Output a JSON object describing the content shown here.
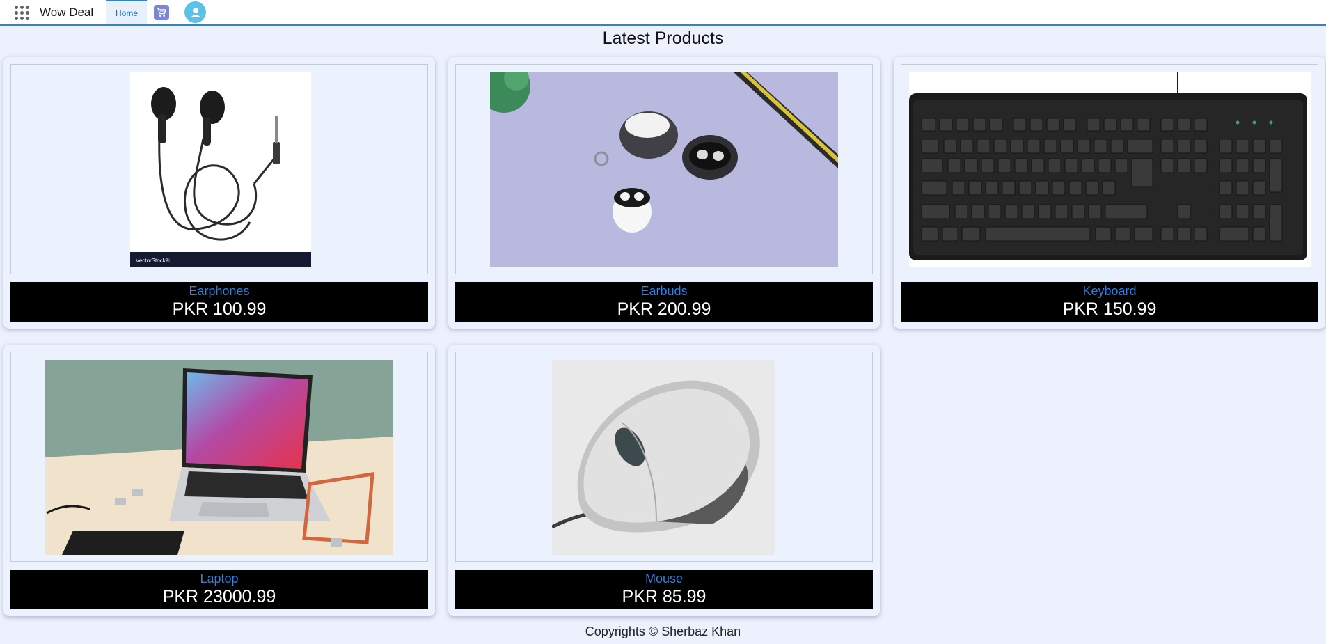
{
  "header": {
    "app_name": "Wow Deal",
    "tabs": [
      {
        "label": "Home",
        "active": true
      }
    ],
    "icons": [
      "app-launcher-icon",
      "cart-icon",
      "user-icon"
    ],
    "accent_color": "#1b8ad8"
  },
  "main": {
    "heading": "Latest Products",
    "products": [
      {
        "name": "Earphones",
        "price": "PKR 100.99",
        "image": "earphones-image"
      },
      {
        "name": "Earbuds",
        "price": "PKR 200.99",
        "image": "earbuds-image"
      },
      {
        "name": "Keyboard",
        "price": "PKR 150.99",
        "image": "keyboard-image"
      },
      {
        "name": "Laptop",
        "price": "PKR 23000.99",
        "image": "laptop-image"
      },
      {
        "name": "Mouse",
        "price": "PKR 85.99",
        "image": "mouse-image"
      }
    ]
  },
  "footer": {
    "copyright": "Copyrights © Sherbaz Khan"
  },
  "watermark": "VectorStock®"
}
